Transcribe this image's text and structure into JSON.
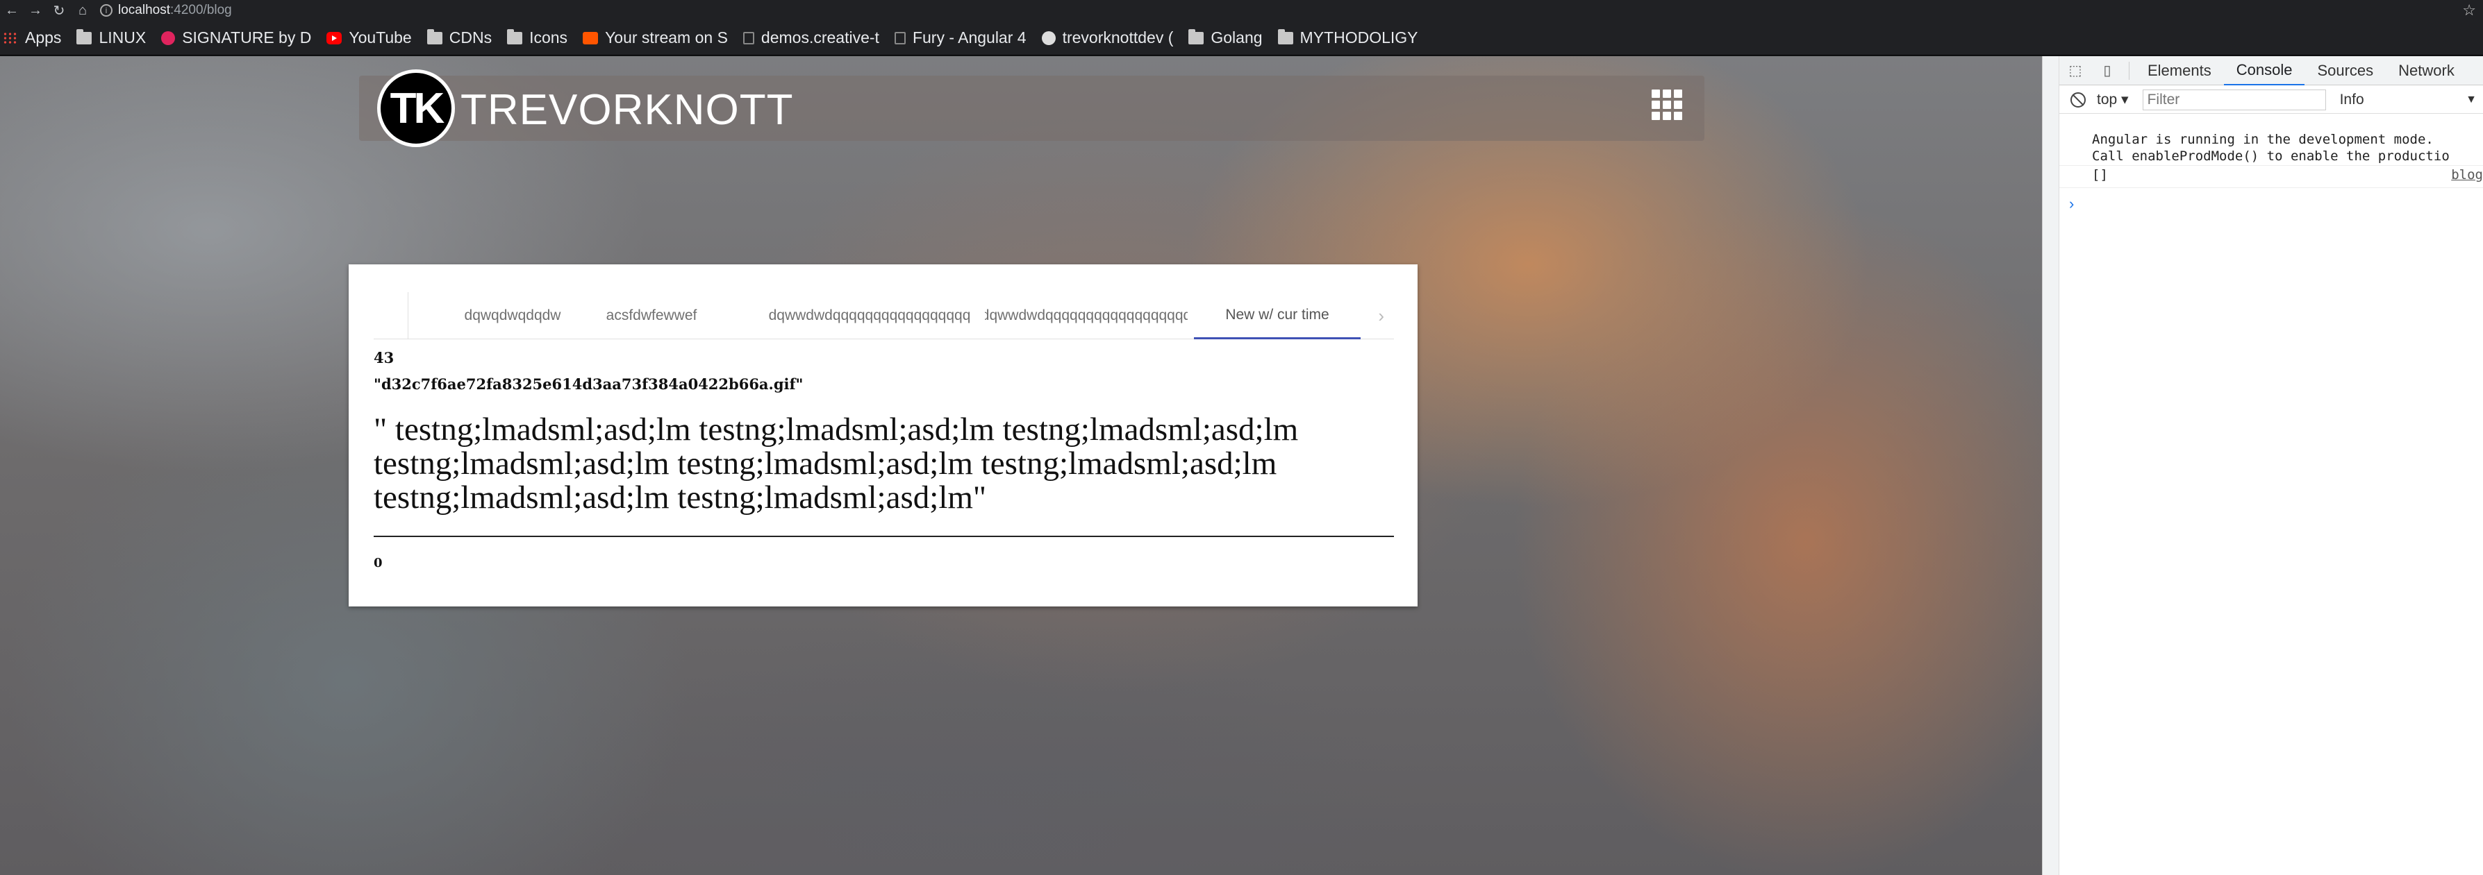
{
  "browser": {
    "url_host": "localhost",
    "url_path": ":4200/blog",
    "bookmarks": [
      {
        "label": "Apps",
        "icon": "apps-grid-icon"
      },
      {
        "label": "LINUX",
        "icon": "folder-icon"
      },
      {
        "label": "SIGNATURE by D",
        "icon": "signature-icon"
      },
      {
        "label": "YouTube",
        "icon": "youtube-icon"
      },
      {
        "label": "CDNs",
        "icon": "folder-icon"
      },
      {
        "label": "Icons",
        "icon": "folder-icon"
      },
      {
        "label": "Your stream on S",
        "icon": "soundcloud-icon"
      },
      {
        "label": "demos.creative-t",
        "icon": "page-icon"
      },
      {
        "label": "Fury - Angular 4",
        "icon": "page-icon"
      },
      {
        "label": "trevorknottdev (",
        "icon": "github-icon"
      },
      {
        "label": "Golang",
        "icon": "folder-icon"
      },
      {
        "label": "MYTHODOLIGY",
        "icon": "folder-icon"
      }
    ]
  },
  "header": {
    "logo_text": "TK",
    "brand": "TREVORKNOTT"
  },
  "post": {
    "tabs": [
      {
        "label": "dqwqdwqdqdw",
        "active": false
      },
      {
        "label": "acsfdwfewwef",
        "active": false
      },
      {
        "label": "dqwwdwdqqqqqqqqqqqqqqqqq",
        "active": false
      },
      {
        "label": "dqwwdwdqqqqqqqqqqqqqqqqqq",
        "active": false
      },
      {
        "label": "New w/ cur time",
        "active": true
      }
    ],
    "count": "43",
    "filename": "\"d32c7f6ae72fa8325e614d3aa73f384a0422b66a.gif\"",
    "body": "\" testng;lmadsml;asd;lm testng;lmadsml;asd;lm testng;lmadsml;asd;lm testng;lmadsml;asd;lm testng;lmadsml;asd;lm testng;lmadsml;asd;lm testng;lmadsml;asd;lm testng;lmadsml;asd;lm\"",
    "footer_value": "0"
  },
  "devtools": {
    "tabs": [
      "Elements",
      "Console",
      "Sources",
      "Network"
    ],
    "active_tab": "Console",
    "context": "top",
    "filter_placeholder": "Filter",
    "levels": "Info",
    "messages": [
      {
        "text": "Angular is running in the development mode. \nCall enableProdMode() to enable the productio"
      },
      {
        "text": "[]",
        "source": "blog"
      }
    ],
    "prompt": "›"
  },
  "colors": {
    "tab_indicator": "#3f51b5",
    "devtools_accent": "#1a73e8"
  }
}
